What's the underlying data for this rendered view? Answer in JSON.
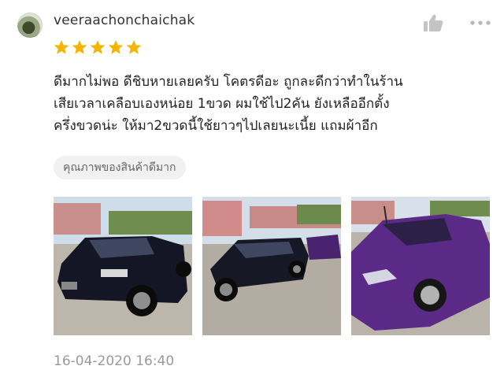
{
  "reviewer": {
    "name": "veeraachonchaichak",
    "avatar_icon": "user-avatar"
  },
  "rating": {
    "value": 5,
    "max": 5,
    "color": "#f5b400"
  },
  "review": {
    "lines": [
      "ดีมากไม่พอ ดีชิบหายเลยครับ โคตรดีอะ ถูกละดีกว่าทำในร้าน",
      "เสียเวลาเคลือบเองหน่อย 1ขวด ผมใช้ไป2คัน ยังเหลืออีกตั้ง",
      "ครึ่งขวดน่ะ ให้มา2ขวดนี้ใช้ยาวๆไปเลยนะเนี้ย แถมผ้าอีก"
    ]
  },
  "tag": "คุณภาพของสินค้าดีมาก",
  "photos": [
    {
      "icon": "black-suv-photo",
      "car_color": "#141626"
    },
    {
      "icon": "black-suv-and-purple-car-photo",
      "car_color": "#161826"
    },
    {
      "icon": "purple-car-photo",
      "car_color": "#5a2a86"
    }
  ],
  "timestamp": "16-04-2020 16:40",
  "actions": {
    "like_icon": "thumbs-up-icon",
    "more_icon": "more-options-icon"
  }
}
